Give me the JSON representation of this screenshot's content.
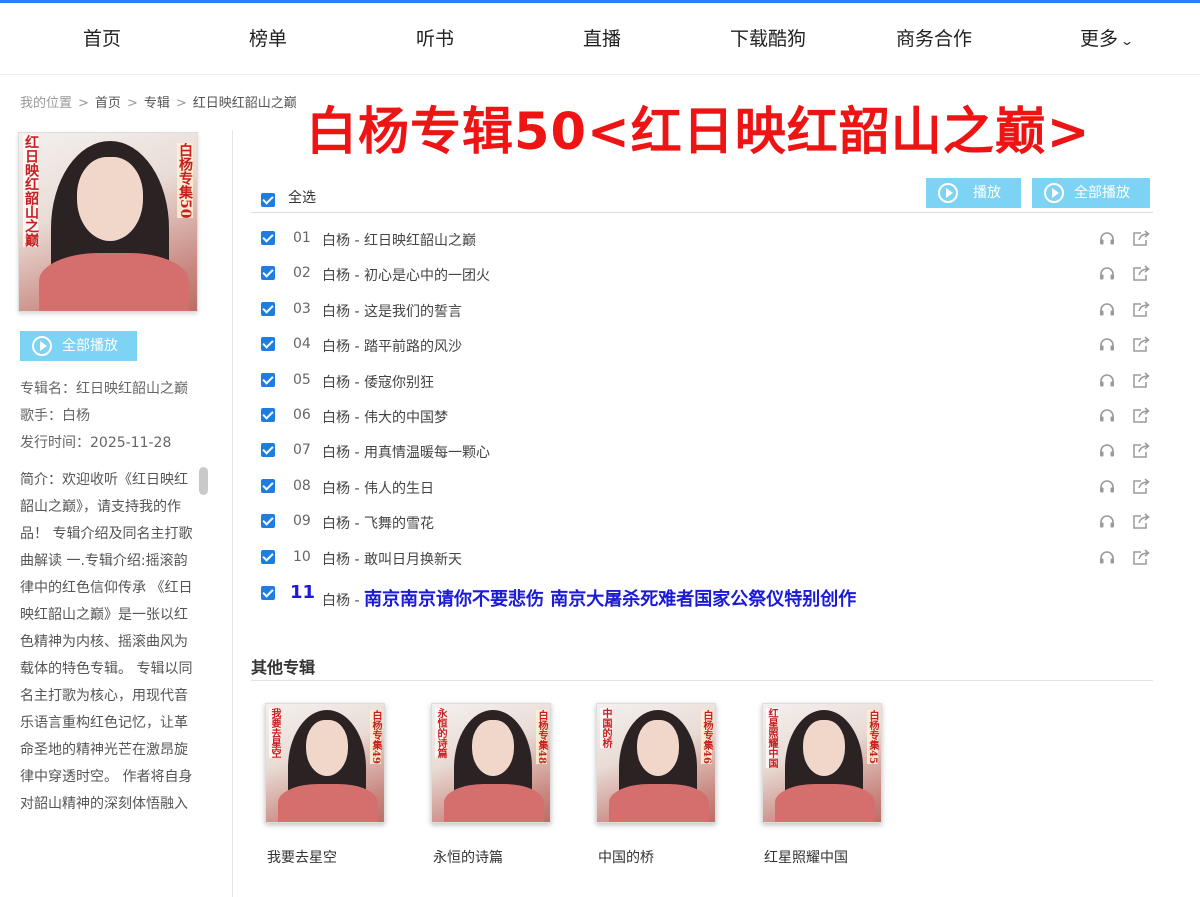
{
  "nav": {
    "items": [
      "首页",
      "榜单",
      "听书",
      "直播",
      "下载酷狗",
      "商务合作",
      "更多"
    ]
  },
  "breadcrumb": {
    "prefix": "我的位置",
    "home": "首页",
    "section": "专辑",
    "current": "红日映红韶山之巅"
  },
  "overlay_title": "白杨专辑50<红日映红韶山之巅>",
  "album": {
    "cover_text_left": "红日映红韶山之巅",
    "cover_text_right": "白杨专集50",
    "play_all_label": "全部播放",
    "name_line": "专辑名：红日映红韶山之巅",
    "singer_line": "歌手：白杨",
    "release_line": "发行时间：2025-11-28",
    "intro": "简介：欢迎收听《红日映红韶山之巅》，请支持我的作品！ 专辑介绍及同名主打歌曲解读 一.专辑介绍:摇滚韵律中的红色信仰传承 《红日映红韶山之巅》是一张以红色精神为内核、摇滚曲风为载体的特色专辑。 专辑以同名主打歌为核心，用现代音乐语言重构红色记忆，让革命圣地的精神光芒在激昂旋律中穿透时空。 作者将自身对韶山精神的深刻体悟融入"
  },
  "tracklist": {
    "select_all": "全选",
    "play_label": "播放",
    "play_all_label": "全部播放",
    "tracks": [
      {
        "num": "01",
        "name": "白杨 - 红日映红韶山之巅"
      },
      {
        "num": "02",
        "name": "白杨 - 初心是心中的一团火"
      },
      {
        "num": "03",
        "name": "白杨 - 这是我们的誓言"
      },
      {
        "num": "04",
        "name": "白杨 - 踏平前路的风沙"
      },
      {
        "num": "05",
        "name": "白杨 - 倭寇你别狂"
      },
      {
        "num": "06",
        "name": "白杨 - 伟大的中国梦"
      },
      {
        "num": "07",
        "name": "白杨 - 用真情温暖每一颗心"
      },
      {
        "num": "08",
        "name": "白杨 - 伟人的生日"
      },
      {
        "num": "09",
        "name": "白杨 - 飞舞的雪花"
      },
      {
        "num": "10",
        "name": "白杨 - 敢叫日月换新天"
      }
    ],
    "special_track": {
      "num": "11",
      "prefix": "白杨 - ",
      "highlight": "南京南京请你不要悲伤  南京大屠杀死难者国家公祭仪特别创作"
    }
  },
  "others": {
    "title": "其他专辑",
    "albums": [
      {
        "name": "我要去星空",
        "cover_left": "我要去星空",
        "cover_right": "白杨专集49"
      },
      {
        "name": "永恒的诗篇",
        "cover_left": "永恒的诗篇",
        "cover_right": "白杨专集48"
      },
      {
        "name": "中国的桥",
        "cover_left": "中国的桥",
        "cover_right": "白杨专集46"
      },
      {
        "name": "红星照耀中国",
        "cover_left": "红星照耀中国",
        "cover_right": "白杨专集45"
      }
    ]
  },
  "colors": {
    "accent_blue": "#2e7cf6",
    "button_cyan": "#7dd3f3",
    "title_red": "#ee1414",
    "highlight_blue": "#1a1ad8"
  }
}
